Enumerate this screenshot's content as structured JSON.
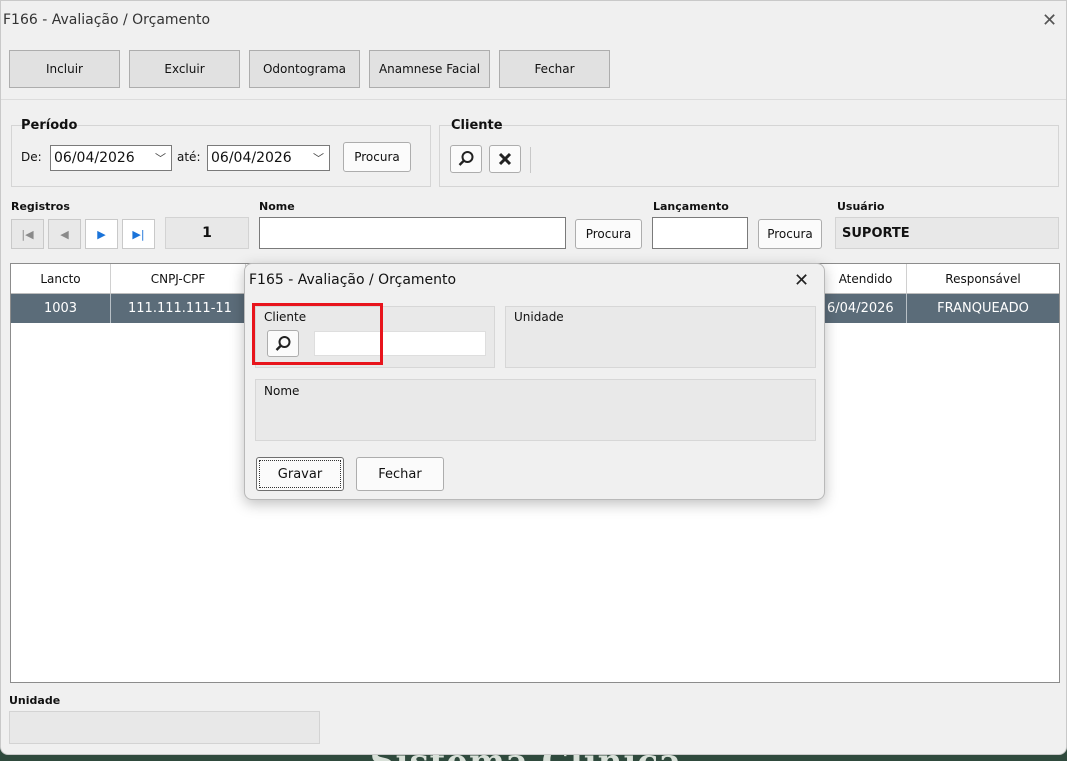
{
  "main_window": {
    "title": "F166 - Avaliação / Orçamento",
    "toolbar": {
      "include_label": "Incluir",
      "delete_label": "Excluir",
      "odontogram_label": "Odontograma",
      "facial_anamnesis_label": "Anamnese Facial",
      "close_label": "Fechar"
    },
    "period": {
      "title": "Período",
      "from_label": "De:",
      "from_value": "06/04/2026",
      "to_label": "até:",
      "to_value": "06/04/2026",
      "search_label": "Procura"
    },
    "client": {
      "title": "Cliente"
    },
    "records": {
      "label": "Registros",
      "count": "1"
    },
    "name_filter": {
      "label": "Nome",
      "value": "",
      "search_label": "Procura"
    },
    "entry_filter": {
      "label": "Lançamento",
      "value": "",
      "search_label": "Procura"
    },
    "user": {
      "label": "Usuário",
      "value": "SUPORTE"
    },
    "grid": {
      "columns": [
        "Lancto",
        "CNPJ-CPF",
        "Atendido",
        "Responsável"
      ],
      "rows": [
        {
          "lancto": "1003",
          "cnpj_cpf": "111.111.111-11",
          "atendido": "6/04/2026",
          "responsavel": "FRANQUEADO"
        }
      ]
    },
    "unit": {
      "label": "Unidade",
      "value": ""
    }
  },
  "background_text": "Sistema Clínica",
  "dialog": {
    "title": "F165 - Avaliação / Orçamento",
    "client_label": "Cliente",
    "client_value": "",
    "unit_label": "Unidade",
    "name_label": "Nome",
    "save_label": "Gravar",
    "close_label": "Fechar"
  },
  "colors": {
    "selected_row": "#5b6c79",
    "highlight_border": "#e8141c",
    "nav_arrow": "#1a73d9"
  }
}
